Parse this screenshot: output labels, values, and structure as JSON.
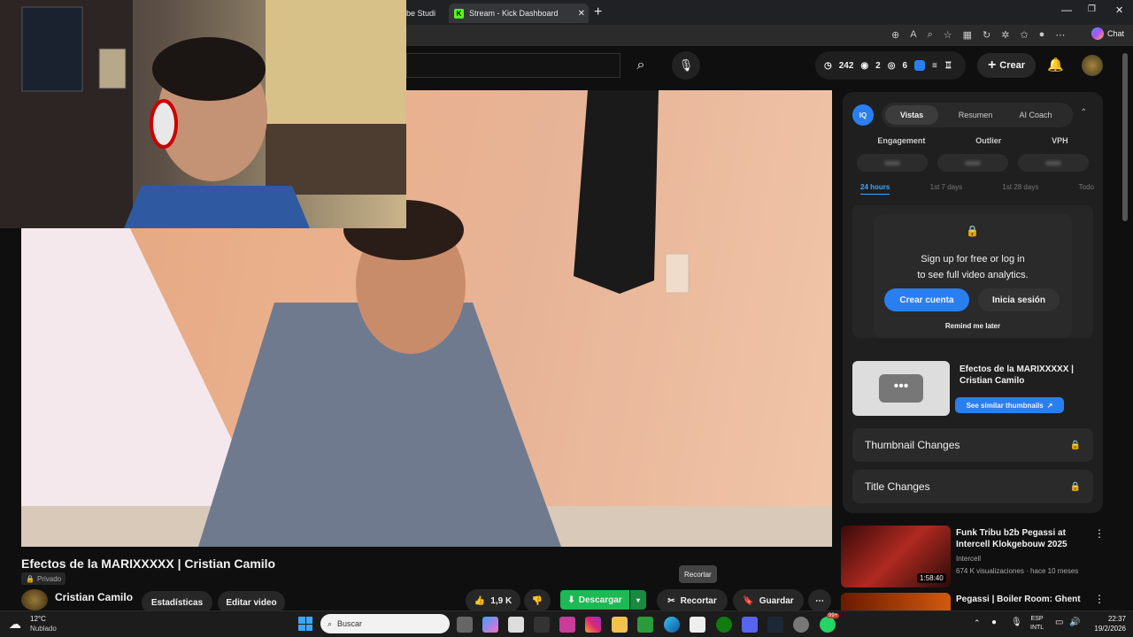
{
  "browser": {
    "tabs": [
      {
        "label": "be Studi"
      },
      {
        "label": "Stream - Kick Dashboard"
      }
    ],
    "chat_label": "Chat"
  },
  "youtube": {
    "stats": {
      "views": "242",
      "likes": "2",
      "comments": "6"
    },
    "create_label": "Crear"
  },
  "panel": {
    "tabs": [
      "Vistas",
      "Resumen",
      "AI Coach"
    ],
    "metrics": [
      "Engagement",
      "Outlier",
      "VPH"
    ],
    "ranges": [
      "24 hours",
      "1st 7 days",
      "1st 28 days",
      "Todo"
    ],
    "signup_line1": "Sign up for free or log in",
    "signup_line2": "to see full video analytics.",
    "create_account": "Crear cuenta",
    "login": "Inicia sesión",
    "remind": "Remind me later",
    "video_title": "Efectos de la MARIXXXXX | Cristian Camilo",
    "similar_thumbs": "See similar thumbnails",
    "thumbnail_changes": "Thumbnail Changes",
    "title_changes": "Title Changes"
  },
  "recommendations": [
    {
      "title": "Funk Tribu b2b Pegassi at Intercell Klokgebouw 2025",
      "channel": "Intercell",
      "meta": "674 K visualizaciones · hace 10 meses",
      "duration": "1:58:40"
    },
    {
      "title": "Pegassi | Boiler Room: Ghent",
      "channel": "",
      "meta": "",
      "duration": ""
    }
  ],
  "video": {
    "title": "Efectos de la MARIXXXXX | Cristian Camilo",
    "privacy": "Privado",
    "channel": "Cristian Camilo",
    "stats_btn": "Estadísticas",
    "edit_btn": "Editar video",
    "likes": "1,9 K",
    "download": "Descargar",
    "clip": "Recortar",
    "save": "Guardar",
    "tooltip": "Recortar"
  },
  "taskbar": {
    "temp": "12°C",
    "weather": "Nublado",
    "search_placeholder": "Buscar",
    "lang1": "ESP",
    "lang2": "INTL",
    "time": "22:37",
    "date": "19/2/2026",
    "badge": "99+"
  },
  "colors": {
    "accent_blue": "#3ea6ff",
    "btn_blue": "#2a7ff0",
    "download_green": "#1db954"
  }
}
